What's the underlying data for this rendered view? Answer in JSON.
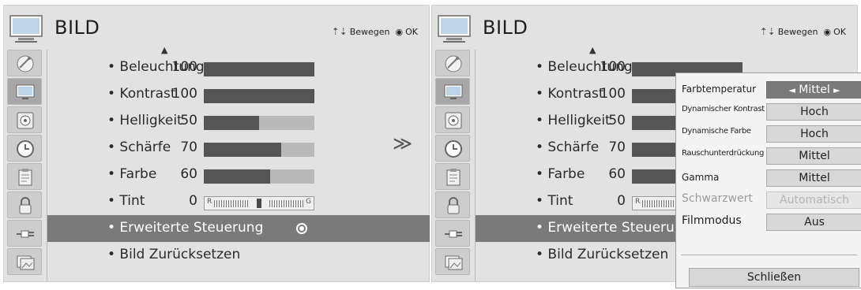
{
  "left_panel": {
    "title": "BILD",
    "hint_move": "Bewegen",
    "hint_ok": "OK",
    "items": [
      {
        "label": "• Beleuchtung.",
        "value": "100",
        "level": 100
      },
      {
        "label": "• Kontrast",
        "value": "100",
        "level": 100
      },
      {
        "label": "• Helligkeit",
        "value": "50",
        "level": 50
      },
      {
        "label": "• Schärfe",
        "value": "70",
        "level": 70
      },
      {
        "label": "• Farbe",
        "value": "60",
        "level": 60
      },
      {
        "label": "• Tint",
        "value": "0",
        "tint_left": "R",
        "tint_right": "G"
      },
      {
        "label": "• Erweiterte Steuerung"
      },
      {
        "label": "• Bild Zurücksetzen"
      }
    ]
  },
  "right_panel": {
    "title": "BILD",
    "hint_move": "Bewegen",
    "hint_ok": "OK",
    "items": [
      {
        "label": "• Beleuchtung.",
        "value": "100"
      },
      {
        "label": "• Kontrast",
        "value": "100"
      },
      {
        "label": "• Helligkeit",
        "value": "50"
      },
      {
        "label": "• Schärfe",
        "value": "70"
      },
      {
        "label": "• Farbe",
        "value": "60"
      },
      {
        "label": "• Tint",
        "value": "0",
        "tint_left": "R"
      },
      {
        "label": "• Erweiterte Steuerung"
      },
      {
        "label": "• Bild Zurücksetzen"
      }
    ]
  },
  "arrow": "≫",
  "submenu": {
    "rows": [
      {
        "label": "Farbtemperatur",
        "value": "Mittel",
        "arrow_left": "◄",
        "arrow_right": "►"
      },
      {
        "label": "Dynamischer Kontrast",
        "value": "Hoch"
      },
      {
        "label": "Dynamische Farbe",
        "value": "Hoch"
      },
      {
        "label": "Rauschunterdrückung",
        "value": "Mittel"
      },
      {
        "label": "Gamma",
        "value": "Mittel"
      },
      {
        "label": "Schwarzwert",
        "value": "Automatisch"
      },
      {
        "label": "Filmmodus",
        "value": "Aus"
      }
    ],
    "close": "Schließen"
  },
  "colors": {
    "panel_bg": "#e2e2e2",
    "bar_fill": "#555555",
    "bar_track": "#b9b9b9",
    "selected_row": "#7a7a7a"
  }
}
